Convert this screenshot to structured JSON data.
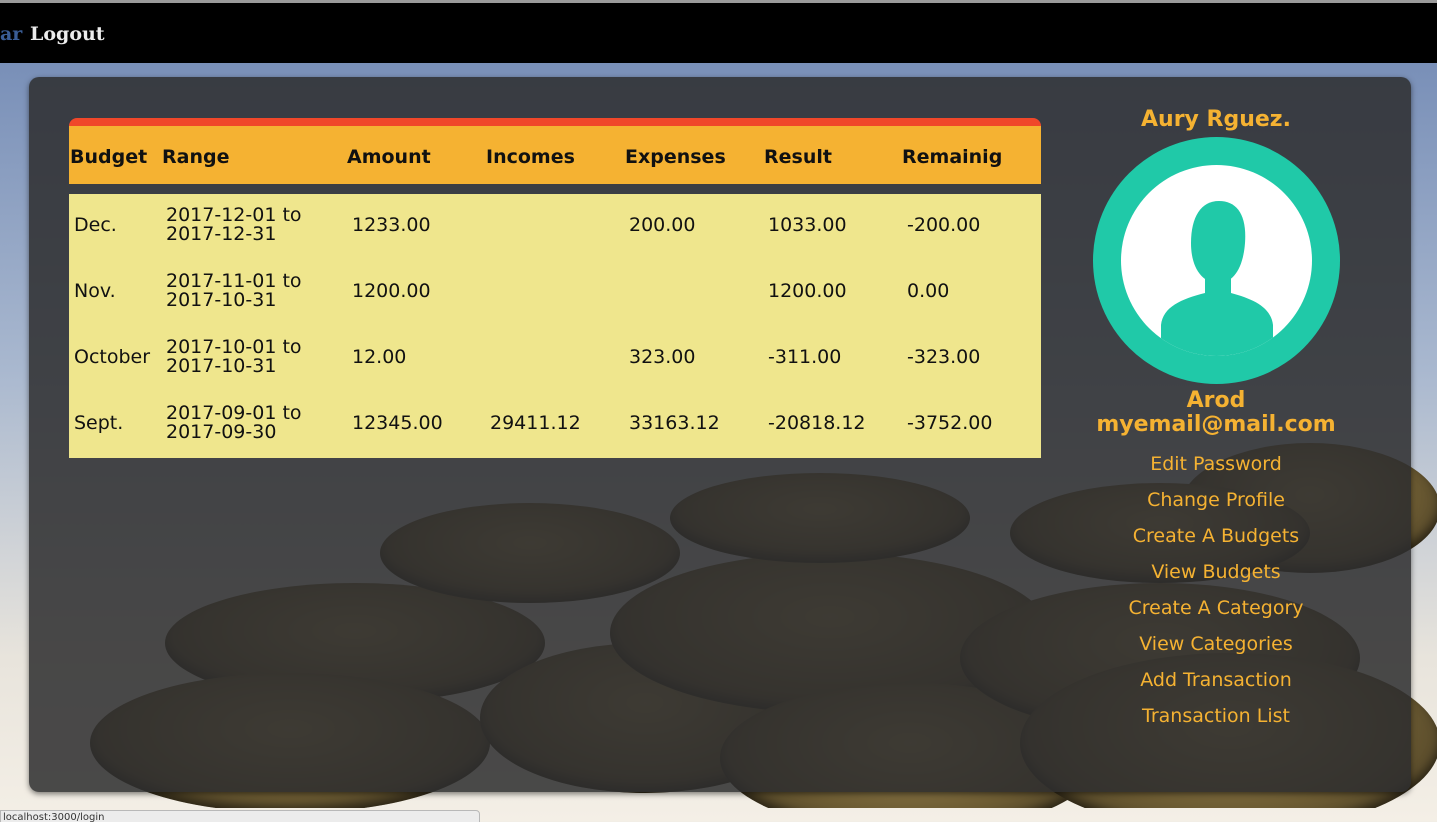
{
  "topbar": {
    "brand_tail": "ar",
    "logout_label": "Logout"
  },
  "table": {
    "headers": [
      "Budget",
      "Range",
      "Amount",
      "Incomes",
      "Expenses",
      "Result",
      "Remainig"
    ],
    "rows": [
      {
        "budget": "Dec.",
        "range_start": "2017-12-01 to",
        "range_end": "2017-12-31",
        "amount": "1233.00",
        "incomes": "",
        "expenses": "200.00",
        "result": "1033.00",
        "remaining": "-200.00"
      },
      {
        "budget": "Nov.",
        "range_start": "2017-11-01 to",
        "range_end": "2017-10-31",
        "amount": "1200.00",
        "incomes": "",
        "expenses": "",
        "result": "1200.00",
        "remaining": "0.00"
      },
      {
        "budget": "October",
        "range_start": "2017-10-01 to",
        "range_end": "2017-10-31",
        "amount": "12.00",
        "incomes": "",
        "expenses": "323.00",
        "result": "-311.00",
        "remaining": "-323.00"
      },
      {
        "budget": "Sept.",
        "range_start": "2017-09-01 to",
        "range_end": "2017-09-30",
        "amount": "12345.00",
        "incomes": "29411.12",
        "expenses": "33163.12",
        "result": "-20818.12",
        "remaining": "-3752.00"
      }
    ]
  },
  "profile": {
    "name": "Aury Rguez.",
    "avatar_icon": "user-silhouette-icon",
    "username": "Arod",
    "email": "myemail@mail.com",
    "menu": [
      "Edit Password",
      "Change Profile",
      "Create A Budgets",
      "View Budgets",
      "Create A Category",
      "View Categories",
      "Add Transaction",
      "Transaction List"
    ]
  },
  "statusbar": {
    "url": "localhost:3000/login"
  },
  "colors": {
    "accent": "#f5b232",
    "header_top_border": "#f0472a",
    "table_body": "#efe68d",
    "avatar_ring": "#20c9a8",
    "panel": "#2d2d2f"
  }
}
